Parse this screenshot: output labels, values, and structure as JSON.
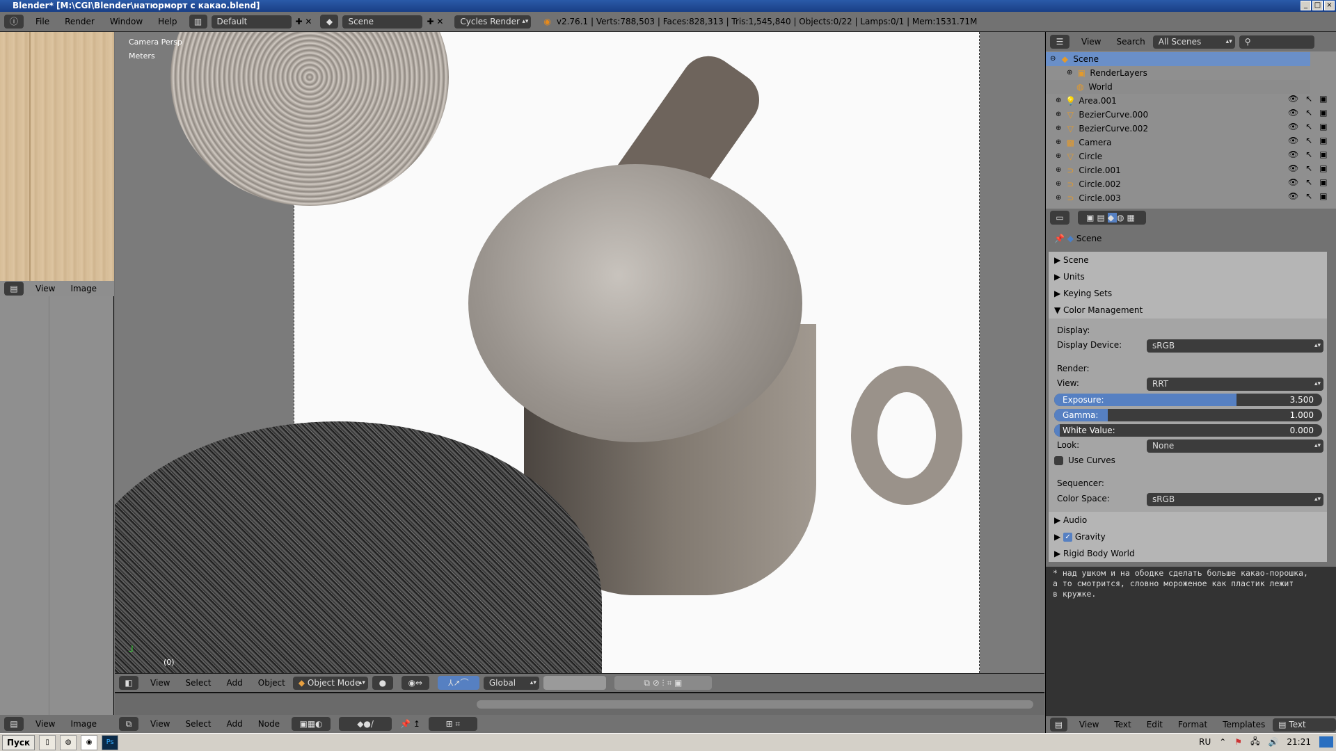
{
  "window": {
    "title": "Blender* [M:\\CGI\\Blender\\натюрморт с какао.blend]",
    "controls": [
      "_",
      "□",
      "×"
    ]
  },
  "topbar": {
    "menus": [
      "File",
      "Render",
      "Window",
      "Help"
    ],
    "layout": "Default",
    "scene": "Scene",
    "engine": "Cycles Render",
    "stats": "v2.76.1 | Verts:788,503 | Faces:828,313 | Tris:1,545,840 | Objects:0/22 | Lamps:0/1 | Mem:1531.71M"
  },
  "image_editor": {
    "menus": [
      "View",
      "Image"
    ]
  },
  "viewport": {
    "overlay_view": "Camera Persp",
    "overlay_units": "Meters",
    "frame": "(0)",
    "header": {
      "menus": [
        "View",
        "Select",
        "Add",
        "Object"
      ],
      "mode": "Object Mode",
      "orientation": "Global"
    }
  },
  "node_editor": {
    "menus": [
      "View",
      "Select",
      "Add",
      "Node"
    ]
  },
  "left_bottom": {
    "menus": [
      "View",
      "Image"
    ]
  },
  "outliner": {
    "menus": [
      "View",
      "Search"
    ],
    "display": "All Scenes",
    "search_placeholder": "",
    "items": [
      {
        "name": "Scene",
        "icon": "scene-icon",
        "selected": true
      },
      {
        "name": "RenderLayers",
        "icon": "render-layers-icon"
      },
      {
        "name": "World",
        "icon": "world-icon"
      },
      {
        "name": "Area.001",
        "icon": "lamp-icon"
      },
      {
        "name": "BezierCurve.000",
        "icon": "mesh-icon"
      },
      {
        "name": "BezierCurve.002",
        "icon": "mesh-icon"
      },
      {
        "name": "Camera",
        "icon": "camera-icon"
      },
      {
        "name": "Circle",
        "icon": "mesh-icon"
      },
      {
        "name": "Circle.001",
        "icon": "curve-icon"
      },
      {
        "name": "Circle.002",
        "icon": "curve-icon"
      },
      {
        "name": "Circle.003",
        "icon": "curve-icon"
      }
    ]
  },
  "properties": {
    "context": "Scene",
    "panels_top": [
      "Scene",
      "Units",
      "Keying Sets"
    ],
    "color_management": {
      "title": "Color Management",
      "display_label": "Display:",
      "display_device_label": "Display Device:",
      "display_device": "sRGB",
      "render_label": "Render:",
      "view_label": "View:",
      "view": "RRT",
      "exposure_label": "Exposure:",
      "exposure": "3.500",
      "exposure_fill": 0.68,
      "gamma_label": "Gamma:",
      "gamma": "1.000",
      "gamma_fill": 0.2,
      "white_label": "White Value:",
      "white": "0.000",
      "white_fill": 0.0,
      "look_label": "Look:",
      "look": "None",
      "use_curves": "Use Curves",
      "sequencer_label": "Sequencer:",
      "color_space_label": "Color Space:",
      "color_space": "sRGB"
    },
    "panels_bottom": [
      "Audio",
      "Gravity",
      "Rigid Body World"
    ]
  },
  "text_editor": {
    "content": "* над ушком и на ободке сделать больше какао-порошка,\nа то смотрится, словно мороженое как пластик лежит\nв кружке.",
    "menus": [
      "View",
      "Text",
      "Edit",
      "Format",
      "Templates"
    ],
    "datablock": "Text"
  },
  "taskbar": {
    "start": "Пуск",
    "lang": "RU",
    "clock": "21:21"
  },
  "colors": {
    "accent": "#5680c2",
    "header": "#727272",
    "field": "#3c3c3c"
  }
}
